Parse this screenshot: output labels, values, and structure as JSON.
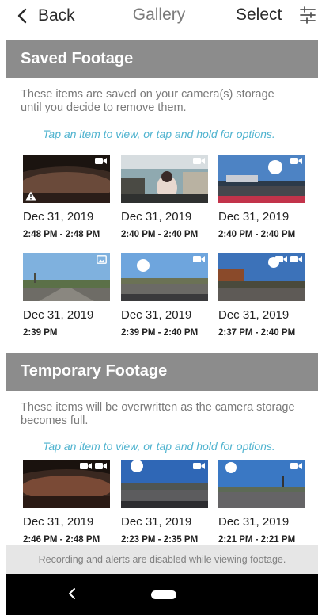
{
  "header": {
    "back_label": "Back",
    "title": "Gallery",
    "select_label": "Select",
    "filter_icon": "sliders-icon"
  },
  "saved": {
    "title": "Saved Footage",
    "description": "These items are saved on your camera(s) storage until you decide to remove them.",
    "hint": "Tap an item to view, or tap and hold for options.",
    "items": [
      {
        "date": "Dec 31, 2019",
        "time": "2:48 PM - 2:48 PM",
        "type": "video",
        "icons": [
          "video-camera-icon"
        ],
        "warning": true
      },
      {
        "date": "Dec 31, 2019",
        "time": "2:40 PM - 2:40 PM",
        "type": "video",
        "icons": [
          "video-camera-icon"
        ],
        "warning": false
      },
      {
        "date": "Dec 31, 2019",
        "time": "2:40 PM - 2:40 PM",
        "type": "video",
        "icons": [
          "video-camera-icon"
        ],
        "warning": false
      },
      {
        "date": "Dec 31, 2019",
        "time": "2:39 PM",
        "type": "photo",
        "icons": [
          "photo-icon"
        ],
        "warning": false
      },
      {
        "date": "Dec 31, 2019",
        "time": "2:39 PM - 2:40 PM",
        "type": "video",
        "icons": [
          "video-camera-icon"
        ],
        "warning": false
      },
      {
        "date": "Dec 31, 2019",
        "time": "2:37 PM - 2:40 PM",
        "type": "video",
        "icons": [
          "video-camera-icon",
          "video-camera-icon"
        ],
        "warning": false
      }
    ]
  },
  "temporary": {
    "title": "Temporary Footage",
    "description": "These items will be overwritten as the camera storage becomes full.",
    "hint": "Tap an item to view, or tap and hold for options.",
    "items": [
      {
        "date": "Dec 31, 2019",
        "time": "2:46 PM - 2:48 PM",
        "type": "video",
        "icons": [
          "video-camera-icon",
          "video-camera-icon"
        ],
        "warning": false
      },
      {
        "date": "Dec 31, 2019",
        "time": "2:23 PM - 2:35 PM",
        "type": "video",
        "icons": [
          "video-camera-icon"
        ],
        "warning": false
      },
      {
        "date": "Dec 31, 2019",
        "time": "2:21 PM - 2:21 PM",
        "type": "video",
        "icons": [
          "video-camera-icon"
        ],
        "warning": false
      }
    ]
  },
  "status_message": "Recording and alerts are disabled while viewing footage.",
  "colors": {
    "accent": "#4fb3cf",
    "section_header": "#8c8c8c",
    "status_bar": "#e6e6e6"
  }
}
